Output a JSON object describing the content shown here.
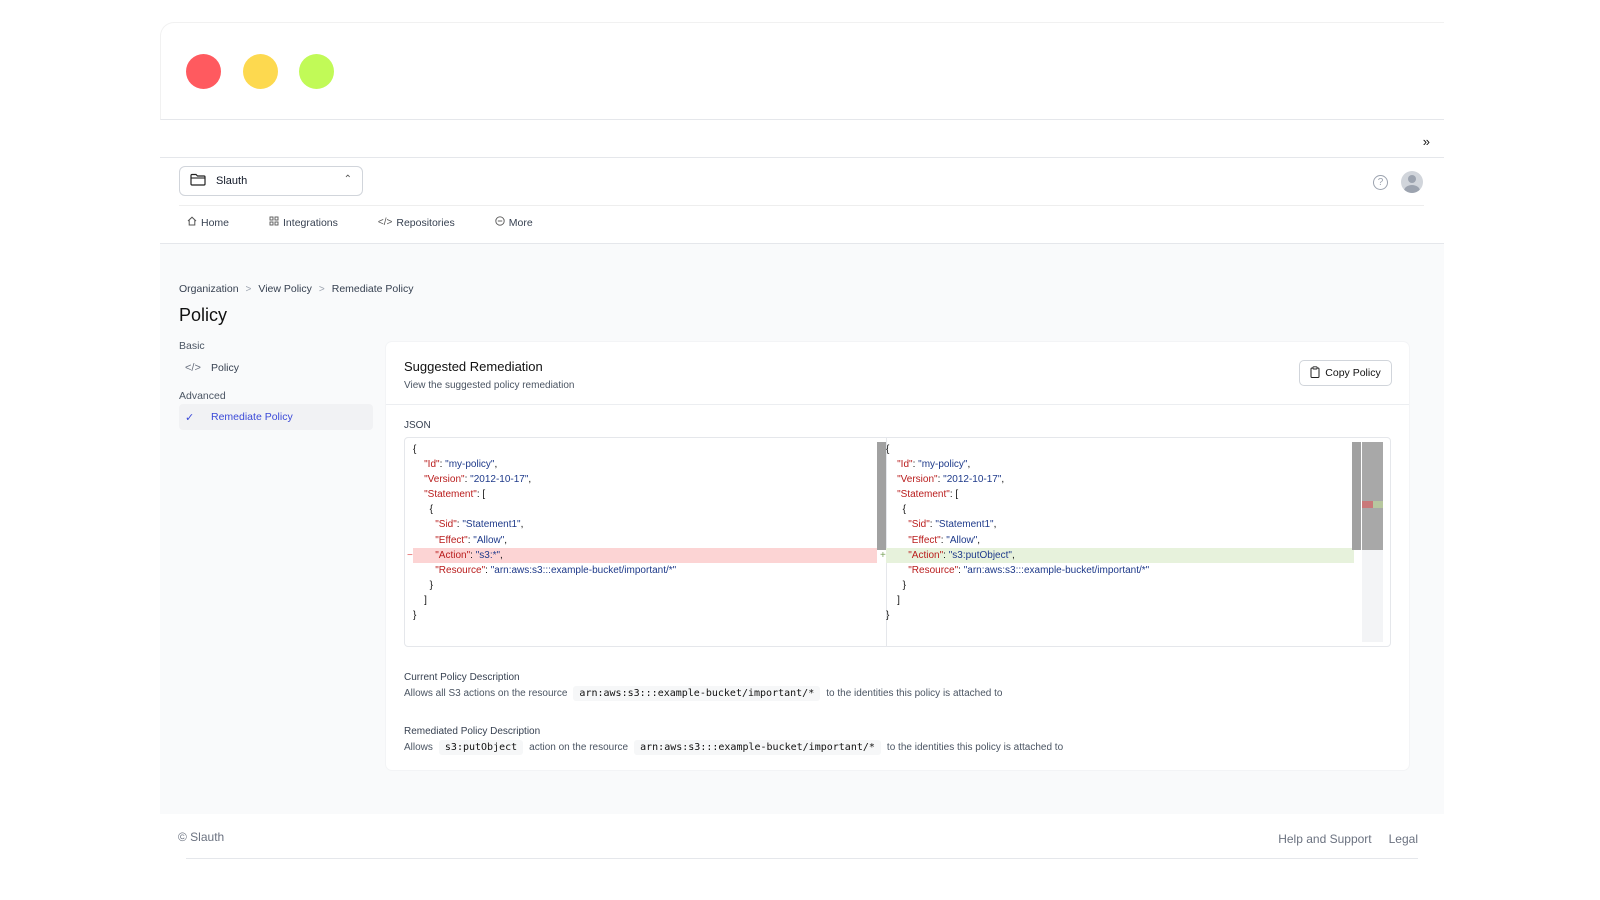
{
  "window": {
    "controls": [
      "close",
      "minimize",
      "maximize"
    ]
  },
  "toolbar": {
    "expand_label": "»"
  },
  "org_select": {
    "value": "Slauth"
  },
  "nav": {
    "items": [
      {
        "label": "Home",
        "icon": "home-icon"
      },
      {
        "label": "Integrations",
        "icon": "grid-icon"
      },
      {
        "label": "Repositories",
        "icon": "code-icon"
      },
      {
        "label": "More",
        "icon": "more-icon"
      }
    ]
  },
  "breadcrumb": {
    "items": [
      "Organization",
      "View Policy",
      "Remediate Policy"
    ]
  },
  "page": {
    "title": "Policy"
  },
  "sidenav": {
    "basic_label": "Basic",
    "policy_label": "Policy",
    "advanced_label": "Advanced",
    "remediate_label": "Remediate Policy"
  },
  "card": {
    "title": "Suggested Remediation",
    "subtitle": "View the suggested policy remediation",
    "copy_label": "Copy Policy",
    "json_label": "JSON"
  },
  "diff": {
    "left": {
      "open": "{",
      "id_key": "\"Id\"",
      "id_val": "\"my-policy\"",
      "version_key": "\"Version\"",
      "version_val": "\"2012-10-17\"",
      "statement_key": "\"Statement\"",
      "sid_key": "\"Sid\"",
      "sid_val": "\"Statement1\"",
      "effect_key": "\"Effect\"",
      "effect_val": "\"Allow\"",
      "action_key": "\"Action\"",
      "action_val": "\"s3:*\"",
      "resource_key": "\"Resource\"",
      "resource_val": "\"arn:aws:s3:::example-bucket/important/*\""
    },
    "right": {
      "id_key": "\"Id\"",
      "id_val": "\"my-policy\"",
      "version_key": "\"Version\"",
      "version_val": "\"2012-10-17\"",
      "statement_key": "\"Statement\"",
      "sid_key": "\"Sid\"",
      "sid_val": "\"Statement1\"",
      "effect_key": "\"Effect\"",
      "effect_val": "\"Allow\"",
      "action_key": "\"Action\"",
      "action_val": "\"s3:putObject\"",
      "resource_key": "\"Resource\"",
      "resource_val": "\"arn:aws:s3:::example-bucket/important/*\""
    },
    "removed_marker": "−",
    "added_marker": "+"
  },
  "current_desc": {
    "title": "Current Policy Description",
    "pre": "Allows all S3 actions on the resource",
    "resource": "arn:aws:s3:::example-bucket/important/*",
    "post": "to the identities this policy is attached to"
  },
  "remediated_desc": {
    "title": "Remediated Policy Description",
    "pre": "Allows",
    "action": "s3:putObject",
    "mid": "action on the resource",
    "resource": "arn:aws:s3:::example-bucket/important/*",
    "post": "to the identities this policy is attached to"
  },
  "footer": {
    "copyright": "© Slauth",
    "help": "Help and Support",
    "legal": "Legal"
  },
  "colors": {
    "accent": "#3b4ad8",
    "removed_bg": "#fcd4d4",
    "added_bg": "#e7f2dc",
    "close": "#ff5a5f",
    "minimize": "#fdd94f",
    "maximize": "#c1fa57"
  }
}
